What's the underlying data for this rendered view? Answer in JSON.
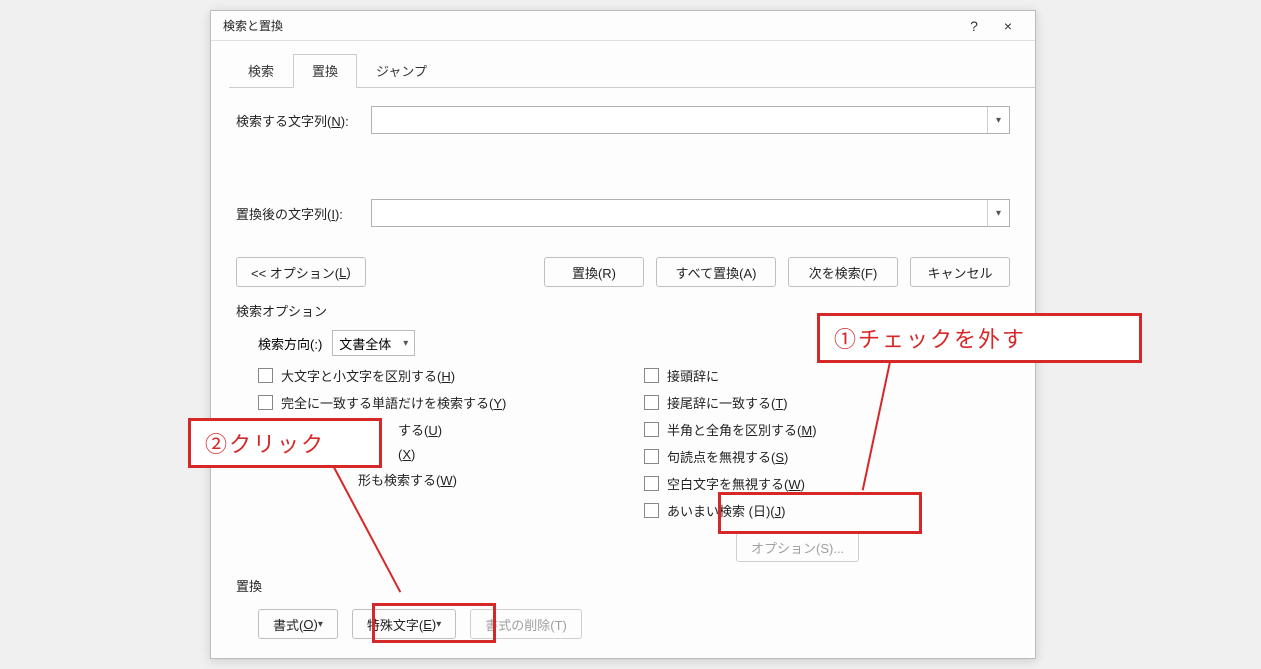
{
  "dialog": {
    "title": "検索と置換",
    "help": "?",
    "close": "×"
  },
  "tabs": {
    "search": "検索",
    "replace": "置換",
    "jump": "ジャンプ"
  },
  "form": {
    "find_label_pre": "検索する文字列(",
    "find_label_ul": "N",
    "find_label_post": "):",
    "replace_label_pre": "置換後の文字列(",
    "replace_label_ul": "I",
    "replace_label_post": "):"
  },
  "buttons": {
    "options_pre": "<< オプション(",
    "options_ul": "L",
    "options_post": ")",
    "replace": "置換(R)",
    "replace_all": "すべて置換(A)",
    "find_next": "次を検索(F)",
    "cancel": "キャンセル"
  },
  "options": {
    "section_label": "検索オプション",
    "direction_label": "検索方向(:)",
    "direction_value": "文書全体",
    "left": [
      {
        "pre": "大文字と小文字を区別する(",
        "ul": "H",
        "post": ")"
      },
      {
        "pre": "完全に一致する単語だけを検索する(",
        "ul": "Y",
        "post": ")"
      },
      {
        "text_tail": "する(",
        "ul": "U",
        "post": ")"
      },
      {
        "text_tail": "(",
        "ul": "X",
        "post": ")"
      },
      {
        "text_tail": "形も検索する(",
        "ul": "W",
        "post": ")"
      }
    ],
    "right": [
      {
        "pre": "接頭辞に",
        "post": ""
      },
      {
        "pre": "接尾辞に一致する(",
        "ul": "T",
        "post": ")"
      },
      {
        "pre": "半角と全角を区別する(",
        "ul": "M",
        "post": ")"
      },
      {
        "pre": "句読点を無視する(",
        "ul": "S",
        "post": ")"
      },
      {
        "pre": "空白文字を無視する(",
        "ul": "W",
        "post": ")"
      },
      {
        "pre": "あいまい検索 (日)(",
        "ul": "J",
        "post": ")"
      }
    ],
    "suboptions_button": "オプション(S)..."
  },
  "replace_section": {
    "label": "置換",
    "format_pre": "書式(",
    "format_ul": "O",
    "format_post": ")",
    "special_pre": "特殊文字(",
    "special_ul": "E",
    "special_post": ")",
    "clear_format": "書式の削除(T)"
  },
  "callouts": {
    "uncheck": "①チェックを外す",
    "click": "②クリック"
  }
}
